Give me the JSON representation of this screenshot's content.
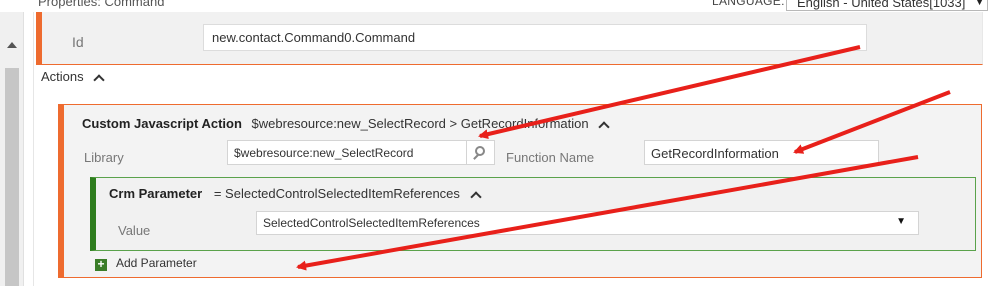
{
  "header": {
    "properties_title": "Properties: Command",
    "language_label": "LANGUAGE:",
    "language_value": "English - United States[1033]"
  },
  "id_field": {
    "label": "Id",
    "value": "new.contact.Command0.Command"
  },
  "actions": {
    "label": "Actions"
  },
  "custom_action": {
    "title": "Custom Javascript Action",
    "summary": "$webresource:new_SelectRecord > GetRecordInformation",
    "library_label": "Library",
    "library_value": "$webresource:new_SelectRecord",
    "function_label": "Function Name",
    "function_value": "GetRecordInformation"
  },
  "crm_parameter": {
    "title": "Crm Parameter",
    "summary": "= SelectedControlSelectedItemReferences",
    "value_label": "Value",
    "value_selected": "SelectedControlSelectedItemReferences"
  },
  "add_parameter": {
    "label": "Add Parameter"
  },
  "icons": {
    "scroll_up": "triangle-up-icon",
    "collapse": "chevron-up-icon",
    "lookup": "search-icon",
    "dropdown": "caret-down-icon",
    "add": "plus-icon"
  },
  "colors": {
    "action_accent": "#ee6b2f",
    "parameter_accent": "#2e7d1e",
    "annotation_arrow": "#e8201a"
  }
}
